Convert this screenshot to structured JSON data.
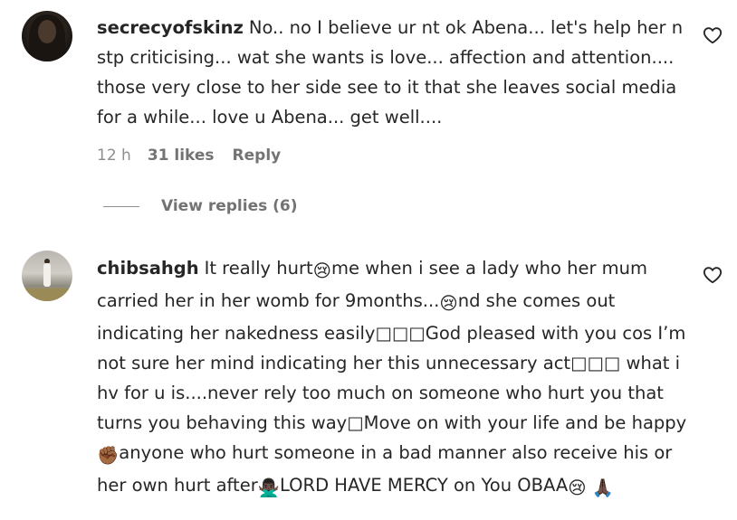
{
  "comments": [
    {
      "username": "secrecyofskinz",
      "text": "No.. no I believe ur nt ok Abena... let's help her n stp criticising... wat she wants is love... affection and attention.... those very close to her side see to it that she leaves social media for a while... love u Abena... get well....",
      "time": "12 h",
      "likes": "31 likes",
      "reply_label": "Reply",
      "view_replies": "View replies (6)",
      "avatar_icon": "profile-photo-dark",
      "like_icon": "heart-outline-icon"
    },
    {
      "username": "chibsahgh",
      "segments": [
        "It really hurt",
        "😢",
        "me when i see a lady who her mum carried her in her womb for 9months...",
        "😢",
        "nd she comes out indicating her nakedness easily□□□God pleased with you cos I’m not sure her mind indicating her this unnecessary act□□□ what i hv for u is....never rely too much on someone who hurt you that turns you behaving this way□Move on with your life and be happy",
        "✊🏾",
        "anyone who hurt someone in a bad manner also receive his or her own hurt after",
        "🙅🏿‍♂️",
        "LORD HAVE MERCY on You OBAA",
        "😢",
        " ",
        "🙏🏿"
      ],
      "avatar_icon": "profile-photo-outdoor",
      "like_icon": "heart-outline-icon"
    }
  ]
}
